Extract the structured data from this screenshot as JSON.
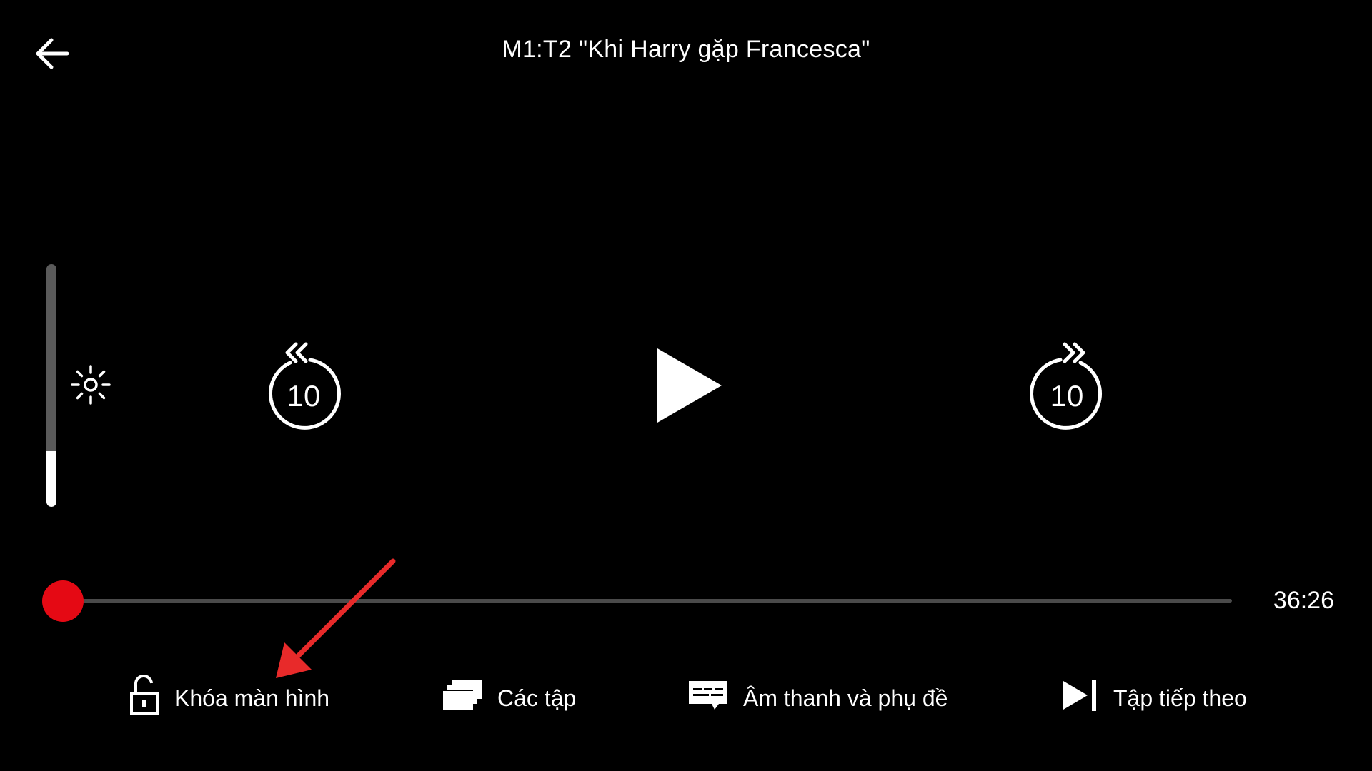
{
  "player": {
    "title": "M1:T2 \"Khi Harry gặp Francesca\"",
    "back_icon": "arrow-left-icon",
    "brightness_icon": "sun-icon",
    "brightness_level": 0.23,
    "rewind": {
      "icon": "rewind-10-icon",
      "label": "10"
    },
    "play": {
      "icon": "play-icon"
    },
    "forward": {
      "icon": "forward-10-icon",
      "label": "10"
    },
    "progress": 0.0,
    "time_remaining": "36:26",
    "accent_color": "#e50914"
  },
  "actions": {
    "lock": {
      "label": "Khóa màn hình",
      "icon": "unlock-icon"
    },
    "episodes": {
      "label": "Các tập",
      "icon": "episodes-stack-icon"
    },
    "audio_subtitles": {
      "label": "Âm thanh và phụ đề",
      "icon": "subtitles-icon"
    },
    "next_episode": {
      "label": "Tập tiếp theo",
      "icon": "next-episode-icon"
    }
  },
  "annotation": {
    "color": "#e82a2a",
    "icon": "red-arrow-annotation"
  }
}
